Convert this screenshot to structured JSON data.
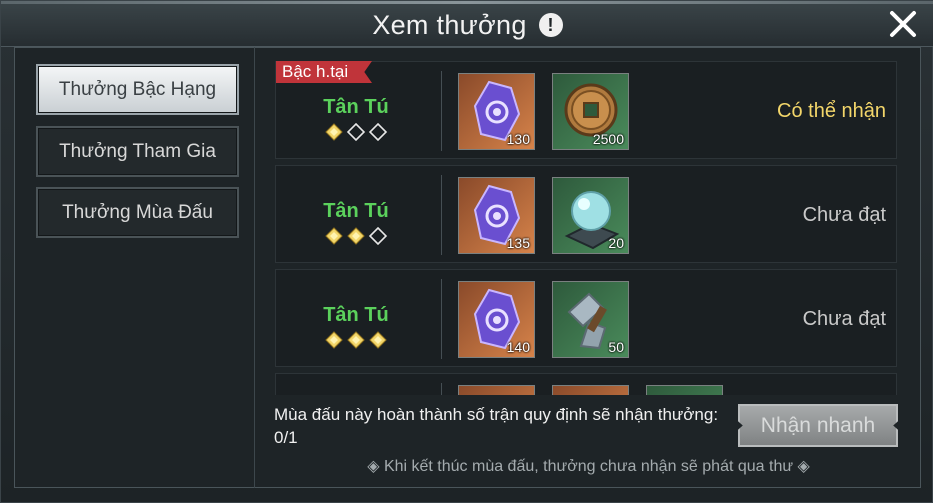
{
  "window": {
    "title": "Xem thưởng"
  },
  "sidebar": {
    "items": [
      {
        "label": "Thưởng Bậc Hạng",
        "active": true
      },
      {
        "label": "Thưởng Tham Gia",
        "active": false
      },
      {
        "label": "Thưởng Mùa Đấu",
        "active": false
      }
    ]
  },
  "rewards": {
    "current_tag": "Bậc h.tại",
    "rows": [
      {
        "rank": "Tân Tú",
        "stars_filled": 1,
        "stars_total": 3,
        "items": [
          {
            "icon": "purple-crystal-icon",
            "qty": "130"
          },
          {
            "icon": "coin-icon",
            "qty": "2500"
          }
        ],
        "status": "Có thể nhận"
      },
      {
        "rank": "Tân Tú",
        "stars_filled": 2,
        "stars_total": 3,
        "items": [
          {
            "icon": "purple-crystal-icon",
            "qty": "135"
          },
          {
            "icon": "crystal-orb-icon",
            "qty": "20"
          }
        ],
        "status": "Chưa đạt"
      },
      {
        "rank": "Tân Tú",
        "stars_filled": 3,
        "stars_total": 3,
        "items": [
          {
            "icon": "purple-crystal-icon",
            "qty": "140"
          },
          {
            "icon": "forge-hammer-icon",
            "qty": "50"
          }
        ],
        "status": "Chưa đạt"
      }
    ]
  },
  "footer": {
    "progress_text": "Mùa đấu này hoàn thành số trận quy định sẽ nhận thưởng: 0/1",
    "quick_claim_label": "Nhận nhanh",
    "note": "◈ Khi kết thúc mùa đấu, thưởng chưa nhận sẽ phát qua thư ◈"
  },
  "colors": {
    "rank_green": "#5bd15c",
    "available_yellow": "#f3d66a",
    "tag_red": "#c0343a"
  }
}
